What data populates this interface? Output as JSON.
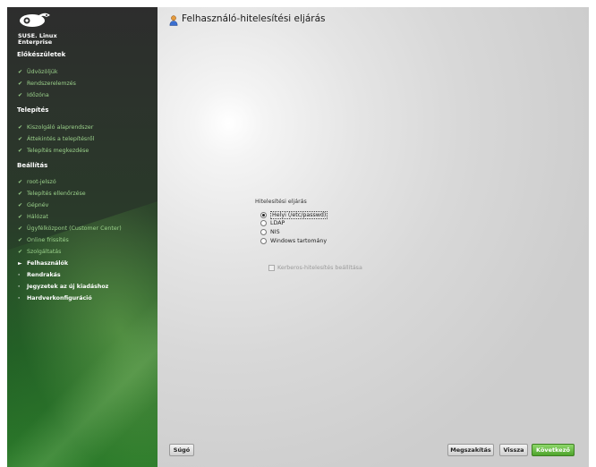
{
  "brand": {
    "line1": "SUSE. Linux",
    "line2": "Enterprise"
  },
  "sidebar": {
    "sections": [
      {
        "title": "Előkészületek",
        "items": [
          {
            "label": "Üdvözöljük",
            "state": "done"
          },
          {
            "label": "Rendszerelemzés",
            "state": "done"
          },
          {
            "label": "Időzóna",
            "state": "done"
          }
        ]
      },
      {
        "title": "Telepítés",
        "items": [
          {
            "label": "Kiszolgáló alaprendszer",
            "state": "done"
          },
          {
            "label": "Áttekintés a telepítésről",
            "state": "done"
          },
          {
            "label": "Telepítés megkezdése",
            "state": "done"
          }
        ]
      },
      {
        "title": "Beállítás",
        "items": [
          {
            "label": "root-jelszó",
            "state": "done"
          },
          {
            "label": "Telepítés ellenőrzése",
            "state": "done"
          },
          {
            "label": "Gépnév",
            "state": "done"
          },
          {
            "label": "Hálózat",
            "state": "done"
          },
          {
            "label": "Ügyfélközpont (Customer Center)",
            "state": "done"
          },
          {
            "label": "Online frissítés",
            "state": "done"
          },
          {
            "label": "Szolgáltatás",
            "state": "done"
          },
          {
            "label": "Felhasználók",
            "state": "current"
          },
          {
            "label": "Rendrakás",
            "state": "todo"
          },
          {
            "label": "Jegyzetek az új kiadáshoz",
            "state": "todo"
          },
          {
            "label": "Hardverkonfiguráció",
            "state": "todo"
          }
        ]
      }
    ]
  },
  "page": {
    "title": "Felhasználó-hitelesítési eljárás"
  },
  "auth": {
    "group_label": "Hitelesítési eljárás",
    "options": [
      {
        "label": "Helyi (/etc/passwd)",
        "selected": true
      },
      {
        "label": "LDAP",
        "selected": false
      },
      {
        "label": "NIS",
        "selected": false
      },
      {
        "label": "Windows tartomány",
        "selected": false
      }
    ],
    "kerberos_label": "Kerberos-hitelesítés beállítása"
  },
  "buttons": {
    "help": "Súgó",
    "abort": "Megszakítás",
    "back": "Vissza",
    "next": "Következő"
  },
  "colors": {
    "accent": "#4ea42c",
    "done": "#9ad08a"
  },
  "icons": {
    "done": "check-icon",
    "current": "arrow-right-icon",
    "todo": "bullet-icon"
  }
}
